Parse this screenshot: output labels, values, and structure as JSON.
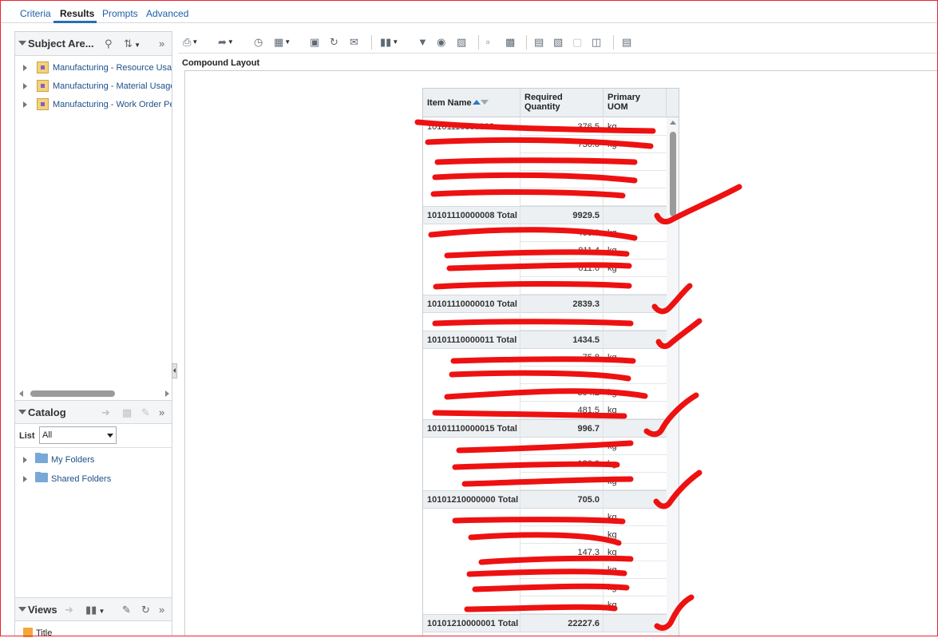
{
  "tabs": [
    {
      "label": "Criteria"
    },
    {
      "label": "Results"
    },
    {
      "label": "Prompts"
    },
    {
      "label": "Advanced"
    }
  ],
  "active_tab": "Results",
  "subject_areas": {
    "title": "Subject Are...",
    "items": [
      {
        "label": "Manufacturing - Resource Usage"
      },
      {
        "label": "Manufacturing - Material Usage"
      },
      {
        "label": "Manufacturing - Work Order Performance"
      }
    ]
  },
  "catalog": {
    "title": "Catalog",
    "list_label": "List",
    "list_value": "All",
    "folders": [
      {
        "label": "My Folders"
      },
      {
        "label": "Shared Folders"
      }
    ]
  },
  "views": {
    "title": "Views",
    "items": [
      {
        "label": "Title"
      }
    ]
  },
  "compound_layout_title": "Compound Layout",
  "table": {
    "headers": {
      "item_name": "Item Name",
      "required_qty_1": "Required",
      "required_qty_2": "Quantity",
      "uom_1": "Primary",
      "uom_2": "UOM"
    },
    "rows": [
      {
        "item": "10101110000008",
        "qty": "376.5",
        "uom": "kg"
      },
      {
        "item": "",
        "qty": "730.0",
        "uom": "kg"
      },
      {
        "item": "",
        "qty": "",
        "uom": ""
      },
      {
        "item": "",
        "qty": "",
        "uom": ""
      },
      {
        "item": "",
        "qty": "",
        "uom": ""
      },
      {
        "total": true,
        "item": "10101110000008 Total",
        "qty": "9929.5",
        "uom": ""
      },
      {
        "item": "",
        "qty": "400.0",
        "uom": "kg"
      },
      {
        "item": "",
        "qty": "811.4",
        "uom": "kg"
      },
      {
        "item": "",
        "qty": "611.6",
        "uom": "kg"
      },
      {
        "item": "",
        "qty": "",
        "uom": ""
      },
      {
        "total": true,
        "item": "10101110000010 Total",
        "qty": "2839.3",
        "uom": ""
      },
      {
        "item": "",
        "qty": "",
        "uom": ""
      },
      {
        "total": true,
        "item": "10101110000011 Total",
        "qty": "1434.5",
        "uom": ""
      },
      {
        "item": "",
        "qty": "75.8",
        "uom": "kg"
      },
      {
        "item": "",
        "qty": "",
        "uom": ""
      },
      {
        "item": "",
        "qty": "304.2",
        "uom": "kg"
      },
      {
        "item": "",
        "qty": "481.5",
        "uom": "kg"
      },
      {
        "total": true,
        "item": "10101110000015 Total",
        "qty": "996.7",
        "uom": ""
      },
      {
        "item": "",
        "qty": "",
        "uom": "kg"
      },
      {
        "item": "",
        "qty": "180.0",
        "uom": "kg"
      },
      {
        "item": "",
        "qty": "",
        "uom": "kg"
      },
      {
        "total": true,
        "item": "10101210000000 Total",
        "qty": "705.0",
        "uom": ""
      },
      {
        "item": "",
        "qty": "",
        "uom": "kg"
      },
      {
        "item": "",
        "qty": "",
        "uom": "kg"
      },
      {
        "item": "",
        "qty": "147.3",
        "uom": "kg"
      },
      {
        "item": "",
        "qty": "",
        "uom": "kg"
      },
      {
        "item": "",
        "qty": "",
        "uom": "kg"
      },
      {
        "item": "",
        "qty": "",
        "uom": "kg"
      },
      {
        "total": true,
        "item": "10101210000001 Total",
        "qty": "22227.6",
        "uom": ""
      }
    ]
  },
  "annotation_color": "#ee1111"
}
